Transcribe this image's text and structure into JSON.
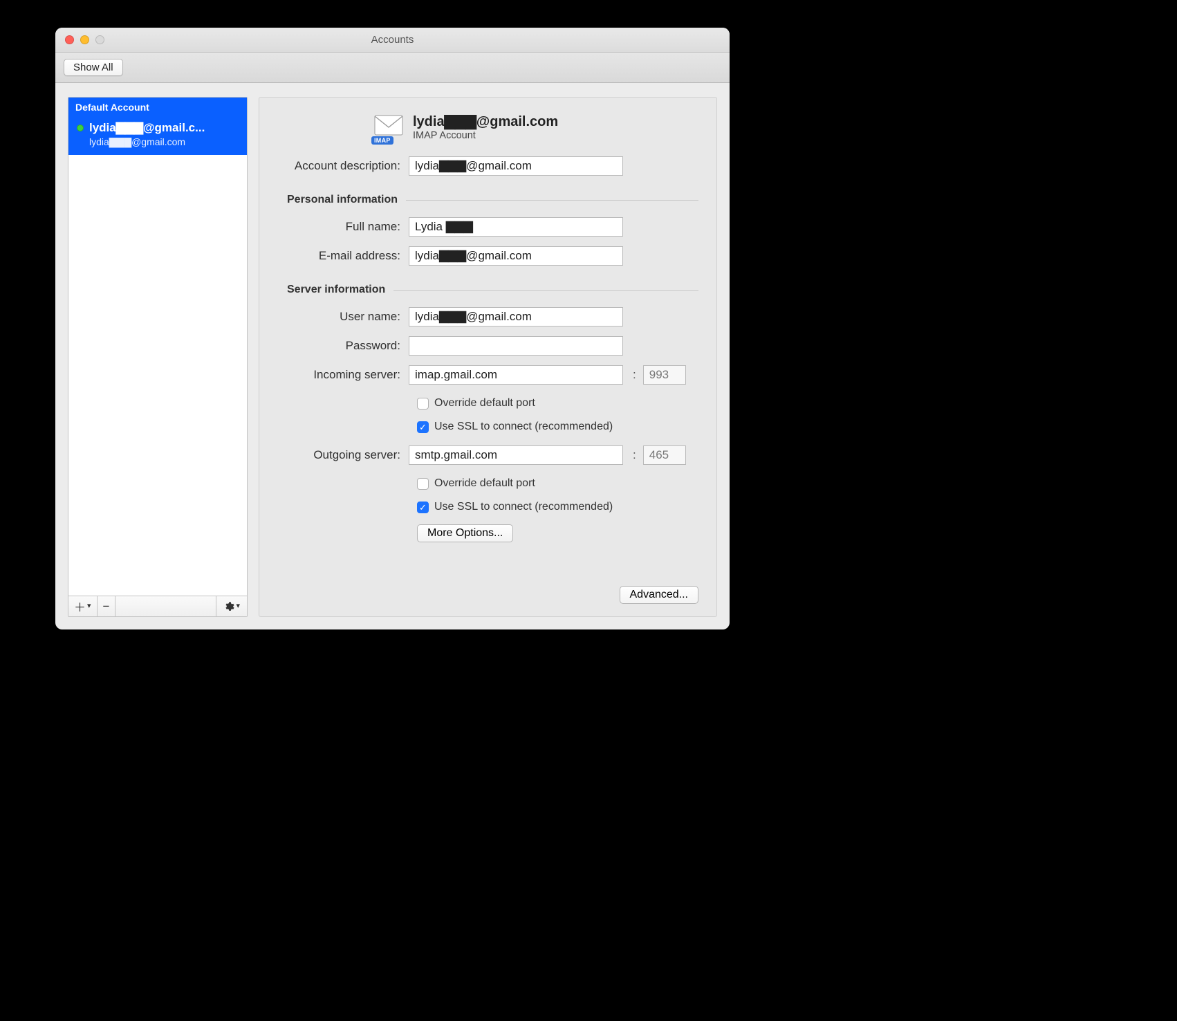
{
  "window": {
    "title": "Accounts",
    "show_all": "Show All"
  },
  "sidebar": {
    "header": "Default Account",
    "item": {
      "title": "lydia▇▇▇@gmail.c...",
      "subtitle": "lydia▇▇▇@gmail.com"
    }
  },
  "detail": {
    "account_title": "lydia▇▇▇@gmail.com",
    "account_type": "IMAP Account",
    "imap_badge": "IMAP",
    "labels": {
      "account_description": "Account description:",
      "personal_info": "Personal information",
      "full_name": "Full name:",
      "email": "E-mail address:",
      "server_info": "Server information",
      "username": "User name:",
      "password": "Password:",
      "incoming": "Incoming server:",
      "outgoing": "Outgoing server:",
      "override_port": "Override default port",
      "use_ssl": "Use SSL to connect (recommended)",
      "more_options": "More Options...",
      "advanced": "Advanced..."
    },
    "values": {
      "account_description": "lydia▇▇▇@gmail.com",
      "full_name": "Lydia ▇▇▇",
      "email": "lydia▇▇▇@gmail.com",
      "username": "lydia▇▇▇@gmail.com",
      "password": "",
      "incoming_server": "imap.gmail.com",
      "incoming_port": "993",
      "outgoing_server": "smtp.gmail.com",
      "outgoing_port": "465"
    },
    "checks": {
      "incoming_override": false,
      "incoming_ssl": true,
      "outgoing_override": false,
      "outgoing_ssl": true
    }
  },
  "port_colon": ":"
}
